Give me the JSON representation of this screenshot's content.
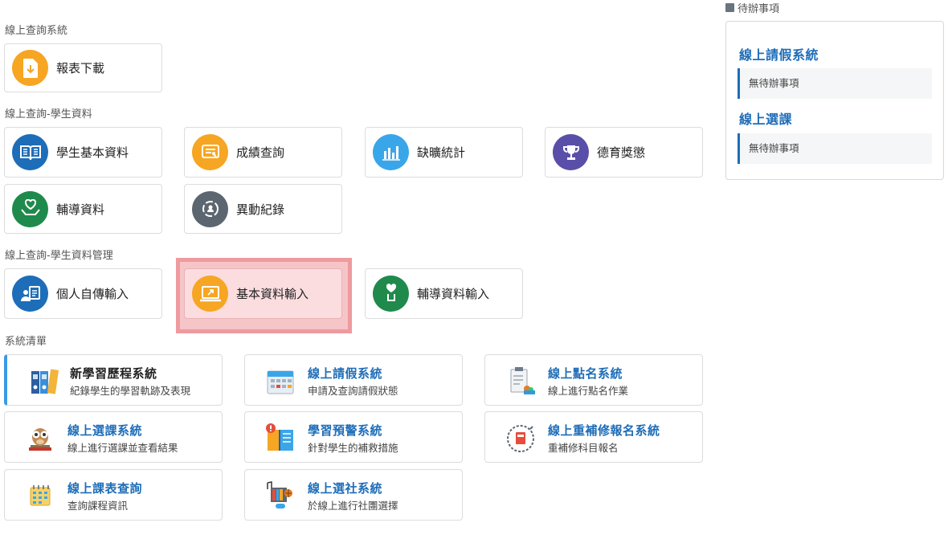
{
  "sections": {
    "online_query": "線上查詢系統",
    "student_data": "線上查詢-學生資料",
    "student_data_mgmt": "線上查詢-學生資料管理",
    "system_list": "系統清單"
  },
  "tiles": {
    "report_download": "報表下載",
    "student_basic": "學生基本資料",
    "grade_query": "成績查詢",
    "absence_stats": "缺曠統計",
    "moral_awards": "德育獎懲",
    "counseling": "輔導資料",
    "change_records": "異動紀錄",
    "autobiography_input": "個人自傳輸入",
    "basic_data_input": "基本資料輸入",
    "counseling_input": "輔導資料輸入"
  },
  "systems": [
    {
      "title": "新學習歷程系統",
      "desc": "紀錄學生的學習軌跡及表現",
      "icon": "binders-icon"
    },
    {
      "title": "線上請假系統",
      "desc": "申請及查詢請假狀態",
      "icon": "calendar-icon"
    },
    {
      "title": "線上點名系統",
      "desc": "線上進行點名作業",
      "icon": "clipboard-icon"
    },
    {
      "title": "線上選課系統",
      "desc": "線上進行選課並查看結果",
      "icon": "owl-books-icon"
    },
    {
      "title": "學習預警系統",
      "desc": "針對學生的補救措施",
      "icon": "warning-book-icon"
    },
    {
      "title": "線上重補修報名系統",
      "desc": "重補修科目報名",
      "icon": "clock-book-icon"
    },
    {
      "title": "線上課表查詢",
      "desc": "查詢課程資訊",
      "icon": "schedule-icon"
    },
    {
      "title": "線上選社系統",
      "desc": "於線上進行社團選擇",
      "icon": "club-icon"
    }
  ],
  "todo": {
    "header": "待辦事項",
    "items": [
      {
        "system": "線上請假系統",
        "status": "無待辦事項"
      },
      {
        "system": "線上選課",
        "status": "無待辦事項"
      }
    ]
  },
  "colors": {
    "orange": "#f6a623",
    "blue": "#1e6db8",
    "sky": "#3aa6ea",
    "purple": "#5a4fa8",
    "green": "#1f8a4c",
    "gray": "#5c6670",
    "highlight": "#ee9a9e"
  }
}
